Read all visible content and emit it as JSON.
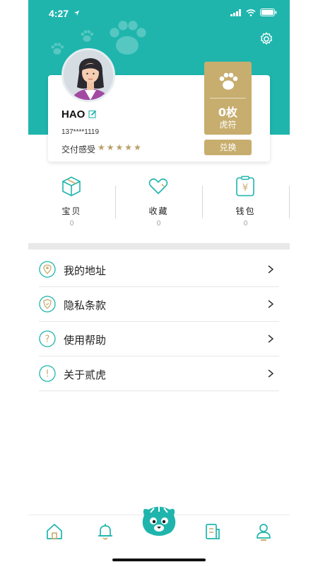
{
  "status_bar": {
    "time": "4:27"
  },
  "profile": {
    "name": "HAO",
    "phone": "137****1119",
    "rating_label": "交付感受",
    "rating_stars": 5
  },
  "coin": {
    "count": "0枚",
    "unit": "虎符",
    "exchange_label": "兑换"
  },
  "quick_actions": [
    {
      "label": "宝贝",
      "count": "0",
      "icon": "box-icon"
    },
    {
      "label": "收藏",
      "count": "0",
      "icon": "heart-icon"
    },
    {
      "label": "钱包",
      "count": "0",
      "icon": "wallet-icon"
    }
  ],
  "menu": [
    {
      "label": "我的地址",
      "icon": "location-icon"
    },
    {
      "label": "隐私条款",
      "icon": "shield-icon"
    },
    {
      "label": "使用帮助",
      "icon": "help-icon"
    },
    {
      "label": "关于贰虎",
      "icon": "info-icon"
    }
  ],
  "tabbar": [
    {
      "icon": "home-icon"
    },
    {
      "icon": "bell-icon"
    },
    {
      "icon": "tiger-icon"
    },
    {
      "icon": "orders-icon"
    },
    {
      "icon": "profile-icon"
    }
  ],
  "colors": {
    "teal": "#1fb5ad",
    "gold": "#c7ad6e",
    "background": "#ffffff"
  }
}
